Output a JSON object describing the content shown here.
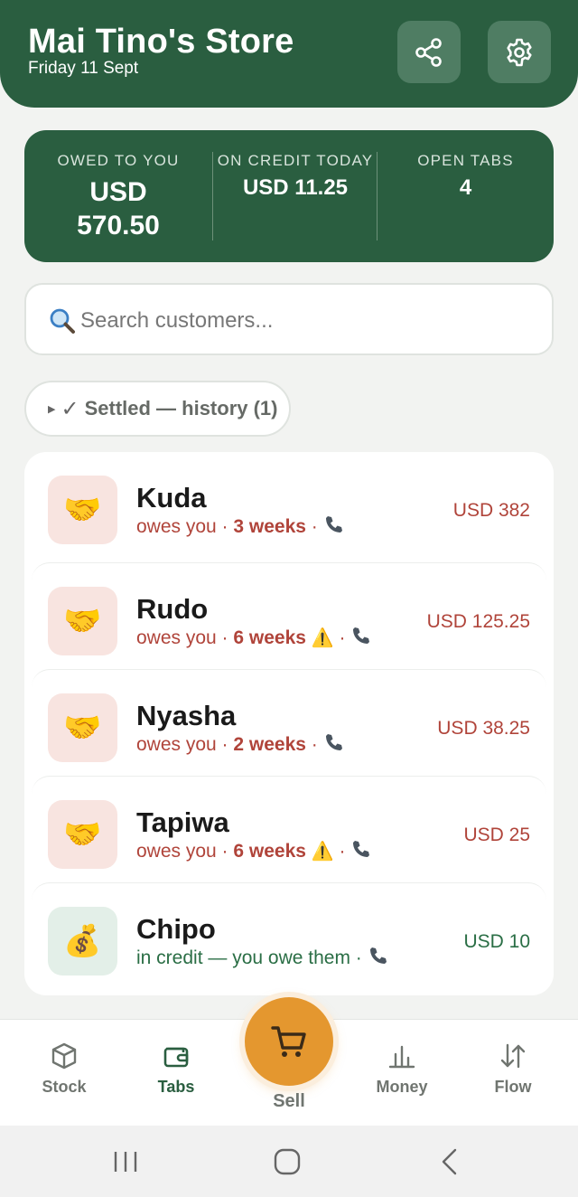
{
  "header": {
    "title": "Mai Tino's Store",
    "date": "Friday 11 Sept",
    "share_icon": "share-icon",
    "settings_icon": "gear-icon"
  },
  "summary": {
    "owed": {
      "label": "OWED TO YOU",
      "value_line1": "USD",
      "value_line2": "570.50"
    },
    "credit_today": {
      "label": "ON CREDIT TODAY",
      "value": "USD 11.25"
    },
    "open_tabs": {
      "label": "OPEN TABS",
      "value": "4"
    }
  },
  "search": {
    "placeholder": "Search customers..."
  },
  "settled": {
    "label": "Settled — history (1)"
  },
  "customers": [
    {
      "name": "Kuda",
      "status": "owes you",
      "age": "3 weeks",
      "warning": false,
      "amount": "USD 382",
      "icon": "handshake"
    },
    {
      "name": "Rudo",
      "status": "owes you",
      "age": "6 weeks",
      "warning": true,
      "amount": "USD 125.25",
      "icon": "handshake"
    },
    {
      "name": "Nyasha",
      "status": "owes you",
      "age": "2 weeks",
      "warning": false,
      "amount": "USD 38.25",
      "icon": "handshake"
    },
    {
      "name": "Tapiwa",
      "status": "owes you",
      "age": "6 weeks",
      "warning": true,
      "amount": "USD 25",
      "icon": "handshake"
    },
    {
      "name": "Chipo",
      "status": "in credit — you owe them",
      "age": "",
      "warning": false,
      "amount": "USD 10",
      "icon": "money-bag"
    }
  ],
  "nav": {
    "stock": "Stock",
    "tabs": "Tabs",
    "sell": "Sell",
    "money": "Money",
    "flow": "Flow",
    "active": "Tabs"
  },
  "colors": {
    "brand_green": "#2a5e40",
    "owed_red": "#b0443a",
    "credit_green": "#2a6e45",
    "sell_orange": "#e4972f"
  }
}
